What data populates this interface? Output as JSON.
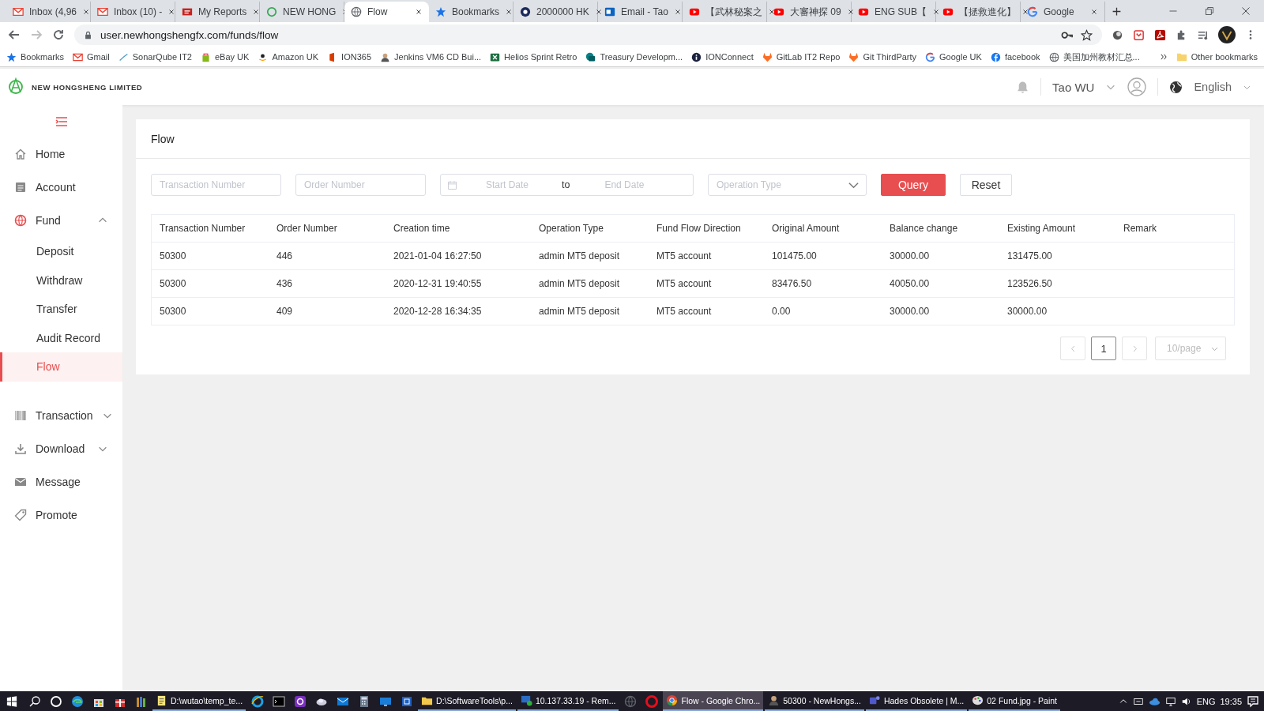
{
  "browser": {
    "tabs": [
      {
        "title": "Inbox (4,96",
        "selected": false
      },
      {
        "title": "Inbox (10) -",
        "selected": false
      },
      {
        "title": "My Reports",
        "selected": false
      },
      {
        "title": "NEW HONG",
        "selected": false
      },
      {
        "title": "Flow",
        "selected": true
      },
      {
        "title": "Bookmarks",
        "selected": false
      },
      {
        "title": "2000000 HK",
        "selected": false
      },
      {
        "title": "Email - Tao",
        "selected": false
      },
      {
        "title": "【武林秘案之",
        "selected": false
      },
      {
        "title": "大審神探 09",
        "selected": false
      },
      {
        "title": "ENG SUB【",
        "selected": false
      },
      {
        "title": "【拯救進化】",
        "selected": false
      },
      {
        "title": "Google",
        "selected": false
      }
    ],
    "address": "user.newhongshengfx.com/funds/flow",
    "bookmarks": [
      "Bookmarks",
      "Gmail",
      "SonarQube IT2",
      "eBay UK",
      "Amazon UK",
      "ION365",
      "Jenkins VM6 CD Bui...",
      "Helios Sprint Retro",
      "Treasury Developm...",
      "IONConnect",
      "GitLab IT2 Repo",
      "Git ThirdParty",
      "Google UK",
      "facebook",
      "美国加州教材汇总..."
    ],
    "other_bookmarks": "Other bookmarks"
  },
  "header": {
    "brand": "NEW HONGSHENG LIMITED",
    "user": "Tao WU",
    "language": "English"
  },
  "sidebar": {
    "items": [
      {
        "label": "Home"
      },
      {
        "label": "Account"
      },
      {
        "label": "Fund",
        "expanded": true,
        "children": [
          {
            "label": "Deposit",
            "selected": false
          },
          {
            "label": "Withdraw",
            "selected": false
          },
          {
            "label": "Transfer",
            "selected": false
          },
          {
            "label": "Audit Record",
            "selected": false
          },
          {
            "label": "Flow",
            "selected": true
          }
        ]
      },
      {
        "label": "Transaction",
        "expanded": false
      },
      {
        "label": "Download",
        "expanded": false
      },
      {
        "label": "Message"
      },
      {
        "label": "Promote"
      }
    ]
  },
  "panel": {
    "title": "Flow",
    "filters": {
      "transaction_number": {
        "placeholder": "Transaction Number"
      },
      "order_number": {
        "placeholder": "Order Number"
      },
      "start_date": {
        "placeholder": "Start Date"
      },
      "range_separator": "to",
      "end_date": {
        "placeholder": "End Date"
      },
      "operation_type": {
        "placeholder": "Operation Type"
      }
    },
    "buttons": [
      {
        "label": "Query",
        "kind": "primary"
      },
      {
        "label": "Reset",
        "kind": "default"
      }
    ],
    "table": {
      "columns": [
        "Transaction Number",
        "Order Number",
        "Creation time",
        "Operation Type",
        "Fund Flow Direction",
        "Original Amount",
        "Balance change",
        "Existing Amount",
        "Remark"
      ],
      "rows": [
        [
          "50300",
          "446",
          "2021-01-04 16:27:50",
          "admin MT5 deposit",
          "MT5 account",
          "101475.00",
          "30000.00",
          "131475.00"
        ],
        [
          "50300",
          "436",
          "2020-12-31 19:40:55",
          "admin MT5 deposit",
          "MT5 account",
          "83476.50",
          "40050.00",
          "123526.50"
        ],
        [
          "50300",
          "409",
          "2020-12-28 16:34:35",
          "admin MT5 deposit",
          "MT5 account",
          "0.00",
          "30000.00",
          "30000.00"
        ]
      ]
    },
    "pagination": {
      "pages": [
        {
          "label": "1",
          "selected": true
        }
      ],
      "page_size": "10/page"
    }
  },
  "taskbar": {
    "items": [
      {
        "kind": "pin"
      },
      {
        "kind": "pin"
      },
      {
        "kind": "pin"
      },
      {
        "kind": "pin"
      },
      {
        "kind": "pin"
      },
      {
        "kind": "pin"
      },
      {
        "kind": "app",
        "label": "D:\\wutao\\temp_te...",
        "active": false
      },
      {
        "kind": "pin"
      },
      {
        "kind": "pin"
      },
      {
        "kind": "pin"
      },
      {
        "kind": "pin"
      },
      {
        "kind": "pin"
      },
      {
        "kind": "pin"
      },
      {
        "kind": "pin"
      },
      {
        "kind": "pin"
      },
      {
        "kind": "app",
        "label": "D:\\SoftwareTools\\p...",
        "active": false
      },
      {
        "kind": "app",
        "label": "10.137.33.19 - Rem...",
        "active": false
      },
      {
        "kind": "pin"
      },
      {
        "kind": "pin"
      },
      {
        "kind": "app",
        "label": "Flow - Google Chro...",
        "active": true
      },
      {
        "kind": "app",
        "label": "50300 - NewHongs...",
        "active": false
      },
      {
        "kind": "app",
        "label": "Hades Obsolete | M...",
        "active": false
      },
      {
        "kind": "app",
        "label": "02 Fund.jpg - Paint",
        "active": false
      }
    ],
    "language": "ENG",
    "time": "19:35"
  }
}
